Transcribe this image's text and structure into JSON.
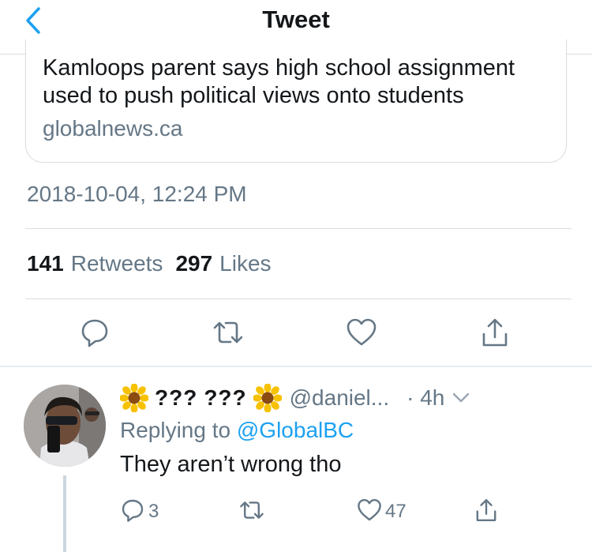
{
  "header": {
    "title": "Tweet",
    "back_icon": "chevron-left-icon"
  },
  "card": {
    "title": "Kamloops parent says high school assignment used to push political views onto students",
    "domain": "globalnews.ca"
  },
  "tweet": {
    "timestamp": "2018-10-04, 12:24 PM",
    "retweet_count": "141",
    "retweet_label": "Retweets",
    "like_count": "297",
    "like_label": "Likes"
  },
  "actions": [
    {
      "icon": "reply-icon"
    },
    {
      "icon": "retweet-icon"
    },
    {
      "icon": "like-icon"
    },
    {
      "icon": "share-icon"
    }
  ],
  "reply": {
    "name_boxes_1": "???",
    "name_boxes_2": "???",
    "handle": "@daniel...",
    "time": "· 4h",
    "replying_prefix": "Replying to",
    "replying_to": "@GlobalBC",
    "text": "They aren’t wrong tho",
    "reply_count": "3",
    "like_count": "47"
  },
  "colors": {
    "accent": "#1da1f2",
    "text": "#14171a",
    "secondary": "#657786",
    "border": "#d8dde2"
  }
}
